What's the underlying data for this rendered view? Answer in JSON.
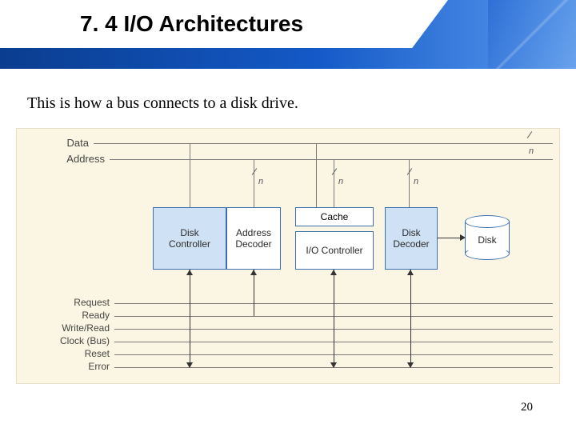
{
  "title": "7. 4 I/O Architectures",
  "caption": "This is how a bus connects to a disk drive.",
  "page_number": "20",
  "bus": {
    "data_label": "Data",
    "address_label": "Address",
    "width_token": "n"
  },
  "blocks": {
    "disk_controller": "Disk\nController",
    "address_decoder": "Address\nDecoder",
    "cache": "Cache",
    "io_controller": "I/O Controller",
    "disk_decoder": "Disk\nDecoder",
    "disk": "Disk"
  },
  "control_lines": [
    "Request",
    "Ready",
    "Write/Read",
    "Clock (Bus)",
    "Reset",
    "Error"
  ]
}
